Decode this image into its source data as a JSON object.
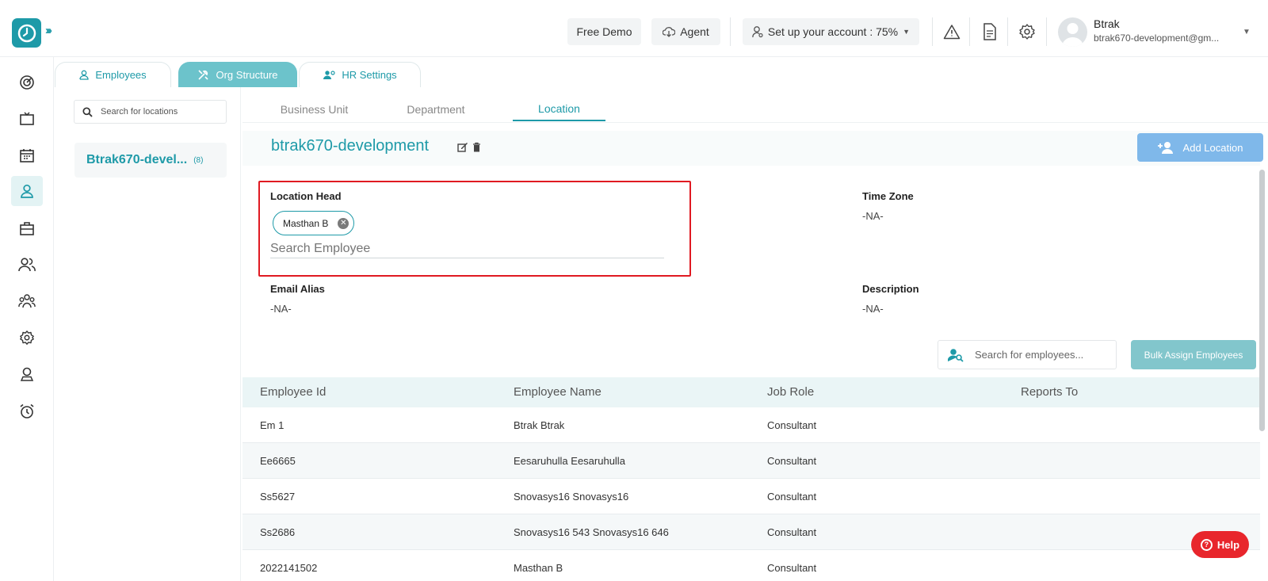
{
  "header": {
    "free_demo": "Free Demo",
    "agent": "Agent",
    "setup": "Set up your account : 75%",
    "user_name": "Btrak",
    "user_email": "btrak670-development@gm..."
  },
  "top_tabs": [
    {
      "label": "Employees"
    },
    {
      "label": "Org Structure"
    },
    {
      "label": "HR Settings"
    }
  ],
  "locations_panel": {
    "search_placeholder": "Search for locations",
    "items": [
      {
        "name": "Btrak670-devel...",
        "count": "(8)"
      }
    ]
  },
  "sub_tabs": [
    {
      "label": "Business Unit"
    },
    {
      "label": "Department"
    },
    {
      "label": "Location"
    }
  ],
  "location": {
    "title": "btrak670-development",
    "add_button": "Add Location",
    "location_head_label": "Location Head",
    "location_head_chip": "Masthan B",
    "employee_search_placeholder": "Search Employee",
    "time_zone_label": "Time Zone",
    "time_zone_value": "-NA-",
    "email_alias_label": "Email Alias",
    "email_alias_value": "-NA-",
    "description_label": "Description",
    "description_value": "-NA-"
  },
  "employees": {
    "search_placeholder": "Search for employees...",
    "bulk_assign": "Bulk Assign Employees",
    "columns": [
      "Employee Id",
      "Employee Name",
      "Job Role",
      "Reports To"
    ],
    "rows": [
      {
        "id": "Em 1",
        "name": "Btrak Btrak",
        "role": "Consultant",
        "reports_to": ""
      },
      {
        "id": "Ee6665",
        "name": "Eesaruhulla Eesaruhulla",
        "role": "Consultant",
        "reports_to": ""
      },
      {
        "id": "Ss5627",
        "name": "Snovasys16 Snovasys16",
        "role": "Consultant",
        "reports_to": ""
      },
      {
        "id": "Ss2686",
        "name": "Snovasys16 543 Snovasys16 646",
        "role": "Consultant",
        "reports_to": ""
      },
      {
        "id": "2022141502",
        "name": "Masthan B",
        "role": "Consultant",
        "reports_to": ""
      }
    ]
  },
  "help": "Help",
  "colors": {
    "brand": "#1e9aa8",
    "highlight": "#e01a22",
    "accent_blue": "#7fb8ea"
  }
}
